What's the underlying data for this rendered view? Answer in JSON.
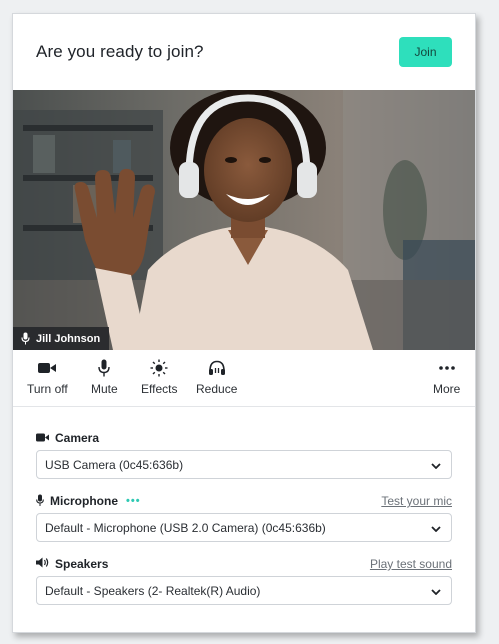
{
  "header": {
    "title": "Are you ready to join?",
    "join_label": "Join"
  },
  "video": {
    "participant_name": "Jill Johnson"
  },
  "controls": [
    {
      "label": "Turn off",
      "icon": "camera-icon"
    },
    {
      "label": "Mute",
      "icon": "microphone-icon"
    },
    {
      "label": "Effects",
      "icon": "sun-icon"
    },
    {
      "label": "Reduce",
      "icon": "headphones-icon"
    },
    {
      "label": "More",
      "icon": "more-dots-icon"
    }
  ],
  "devices": {
    "camera": {
      "title": "Camera",
      "icon": "camera-icon",
      "selected": "USB Camera (0c45:636b)"
    },
    "microphone": {
      "title": "Microphone",
      "icon": "microphone-icon",
      "level_indicator": "•••",
      "action": "Test your mic",
      "selected": "Default - Microphone (USB 2.0 Camera) (0c45:636b)"
    },
    "speakers": {
      "title": "Speakers",
      "icon": "speaker-icon",
      "action": "Play test sound",
      "selected": "Default - Speakers (2- Realtek(R) Audio)"
    }
  },
  "colors": {
    "accent": "#2edfbc",
    "mic_level": "#2ec9b3"
  }
}
